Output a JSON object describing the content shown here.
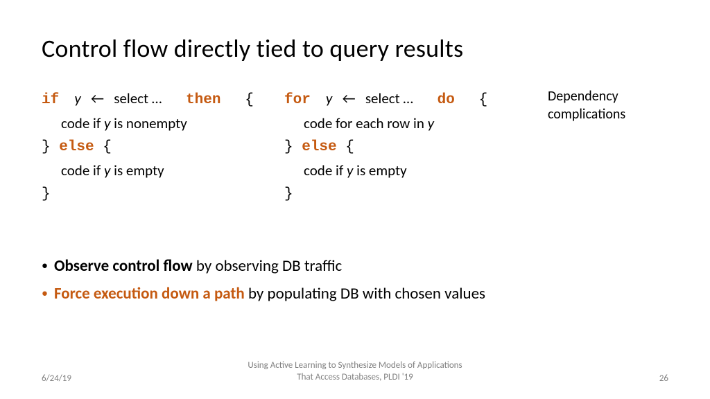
{
  "title": "Control flow directly tied to query results",
  "code_left": {
    "kw_if": "if",
    "y": "y",
    "arrow": "←",
    "select": "select …",
    "kw_then": "then",
    "brace_open": "{",
    "line2a": "code if ",
    "line2b": "y",
    "line2c": " is nonempty",
    "brace_close_else": "} ",
    "kw_else": "else",
    "brace_open2": " {",
    "line4a": "code if ",
    "line4b": "y",
    "line4c": " is empty",
    "brace_close": "}"
  },
  "code_right": {
    "kw_for": "for",
    "y": "y",
    "arrow": "←",
    "select": "select …",
    "kw_do": "do",
    "brace_open": "{",
    "line2a": "code for each row in ",
    "line2b": "y",
    "brace_close_else": "} ",
    "kw_else": "else",
    "brace_open2": " {",
    "line4a": "code if ",
    "line4b": "y",
    "line4c": " is empty",
    "brace_close": "}"
  },
  "side_note": {
    "line1": "Dependency",
    "line2": "complications"
  },
  "bullets": {
    "b1_bold": "Observe control flow",
    "b1_rest": " by observing DB traffic",
    "b2_bold": "Force execution down a path",
    "b2_rest": " by populating DB with chosen values"
  },
  "footer": {
    "date": "6/24/19",
    "center_l1": "Using Active Learning to Synthesize Models of Applications",
    "center_l2": "That Access Databases, PLDI '19",
    "page": "26"
  }
}
